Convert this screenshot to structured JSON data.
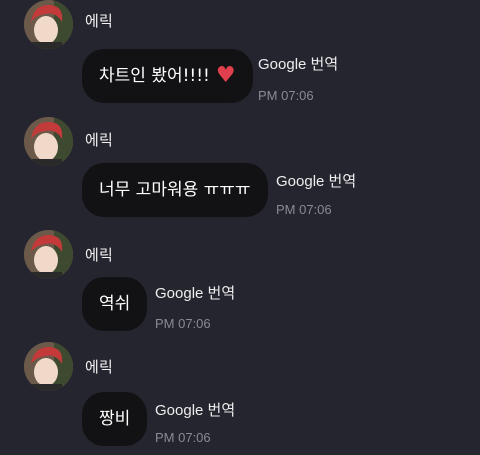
{
  "chat": {
    "messages": [
      {
        "sender": "에릭",
        "text": "차트인 봤어!!!!",
        "has_heart": true,
        "heart_glyph": "♥",
        "heart_color": "#e03f4d",
        "translate_brand": "Google",
        "translate_label": "번역",
        "time": "PM 07:06"
      },
      {
        "sender": "에릭",
        "text": "너무 고마워용 ㅠㅠㅠ",
        "translate_brand": "Google",
        "translate_label": "번역",
        "time": "PM 07:06"
      },
      {
        "sender": "에릭",
        "text": "역쉬",
        "translate_brand": "Google",
        "translate_label": "번역",
        "time": "PM 07:06"
      },
      {
        "sender": "에릭",
        "text": "짱비",
        "translate_brand": "Google",
        "translate_label": "번역",
        "time": "PM 07:06"
      }
    ]
  },
  "theme": {
    "background": "#25252f",
    "bubble": "#121214",
    "timestamp": "#8a8a94"
  }
}
